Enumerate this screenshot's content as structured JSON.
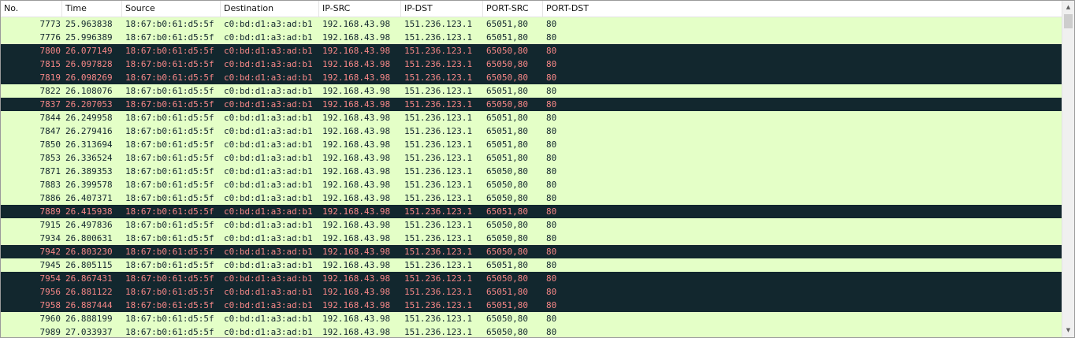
{
  "columns": {
    "no": "No.",
    "time": "Time",
    "source": "Source",
    "destination": "Destination",
    "ip_src": "IP-SRC",
    "ip_dst": "IP-DST",
    "port_src": "PORT-SRC",
    "port_dst": "PORT-DST"
  },
  "colors": {
    "normal_bg": "#e4ffc7",
    "normal_fg": "#12272e",
    "alert_bg": "#12272e",
    "alert_fg": "#f78787"
  },
  "scrollbar": {
    "up_icon": "▲",
    "down_icon": "▼"
  },
  "packets": [
    {
      "no": "7773",
      "time": "25.963838",
      "source": "18:67:b0:61:d5:5f",
      "destination": "c0:bd:d1:a3:ad:b1",
      "ip_src": "192.168.43.98",
      "ip_dst": "151.236.123.1",
      "port_src": "65051,80",
      "port_dst": "80",
      "style": "normal"
    },
    {
      "no": "7776",
      "time": "25.996389",
      "source": "18:67:b0:61:d5:5f",
      "destination": "c0:bd:d1:a3:ad:b1",
      "ip_src": "192.168.43.98",
      "ip_dst": "151.236.123.1",
      "port_src": "65051,80",
      "port_dst": "80",
      "style": "normal"
    },
    {
      "no": "7800",
      "time": "26.077149",
      "source": "18:67:b0:61:d5:5f",
      "destination": "c0:bd:d1:a3:ad:b1",
      "ip_src": "192.168.43.98",
      "ip_dst": "151.236.123.1",
      "port_src": "65050,80",
      "port_dst": "80",
      "style": "alert"
    },
    {
      "no": "7815",
      "time": "26.097828",
      "source": "18:67:b0:61:d5:5f",
      "destination": "c0:bd:d1:a3:ad:b1",
      "ip_src": "192.168.43.98",
      "ip_dst": "151.236.123.1",
      "port_src": "65050,80",
      "port_dst": "80",
      "style": "alert"
    },
    {
      "no": "7819",
      "time": "26.098269",
      "source": "18:67:b0:61:d5:5f",
      "destination": "c0:bd:d1:a3:ad:b1",
      "ip_src": "192.168.43.98",
      "ip_dst": "151.236.123.1",
      "port_src": "65050,80",
      "port_dst": "80",
      "style": "alert"
    },
    {
      "no": "7822",
      "time": "26.108076",
      "source": "18:67:b0:61:d5:5f",
      "destination": "c0:bd:d1:a3:ad:b1",
      "ip_src": "192.168.43.98",
      "ip_dst": "151.236.123.1",
      "port_src": "65051,80",
      "port_dst": "80",
      "style": "normal"
    },
    {
      "no": "7837",
      "time": "26.207053",
      "source": "18:67:b0:61:d5:5f",
      "destination": "c0:bd:d1:a3:ad:b1",
      "ip_src": "192.168.43.98",
      "ip_dst": "151.236.123.1",
      "port_src": "65050,80",
      "port_dst": "80",
      "style": "alert"
    },
    {
      "no": "7844",
      "time": "26.249958",
      "source": "18:67:b0:61:d5:5f",
      "destination": "c0:bd:d1:a3:ad:b1",
      "ip_src": "192.168.43.98",
      "ip_dst": "151.236.123.1",
      "port_src": "65051,80",
      "port_dst": "80",
      "style": "normal"
    },
    {
      "no": "7847",
      "time": "26.279416",
      "source": "18:67:b0:61:d5:5f",
      "destination": "c0:bd:d1:a3:ad:b1",
      "ip_src": "192.168.43.98",
      "ip_dst": "151.236.123.1",
      "port_src": "65051,80",
      "port_dst": "80",
      "style": "normal"
    },
    {
      "no": "7850",
      "time": "26.313694",
      "source": "18:67:b0:61:d5:5f",
      "destination": "c0:bd:d1:a3:ad:b1",
      "ip_src": "192.168.43.98",
      "ip_dst": "151.236.123.1",
      "port_src": "65051,80",
      "port_dst": "80",
      "style": "normal"
    },
    {
      "no": "7853",
      "time": "26.336524",
      "source": "18:67:b0:61:d5:5f",
      "destination": "c0:bd:d1:a3:ad:b1",
      "ip_src": "192.168.43.98",
      "ip_dst": "151.236.123.1",
      "port_src": "65051,80",
      "port_dst": "80",
      "style": "normal"
    },
    {
      "no": "7871",
      "time": "26.389353",
      "source": "18:67:b0:61:d5:5f",
      "destination": "c0:bd:d1:a3:ad:b1",
      "ip_src": "192.168.43.98",
      "ip_dst": "151.236.123.1",
      "port_src": "65050,80",
      "port_dst": "80",
      "style": "normal"
    },
    {
      "no": "7883",
      "time": "26.399578",
      "source": "18:67:b0:61:d5:5f",
      "destination": "c0:bd:d1:a3:ad:b1",
      "ip_src": "192.168.43.98",
      "ip_dst": "151.236.123.1",
      "port_src": "65050,80",
      "port_dst": "80",
      "style": "normal"
    },
    {
      "no": "7886",
      "time": "26.407371",
      "source": "18:67:b0:61:d5:5f",
      "destination": "c0:bd:d1:a3:ad:b1",
      "ip_src": "192.168.43.98",
      "ip_dst": "151.236.123.1",
      "port_src": "65050,80",
      "port_dst": "80",
      "style": "normal"
    },
    {
      "no": "7889",
      "time": "26.415938",
      "source": "18:67:b0:61:d5:5f",
      "destination": "c0:bd:d1:a3:ad:b1",
      "ip_src": "192.168.43.98",
      "ip_dst": "151.236.123.1",
      "port_src": "65051,80",
      "port_dst": "80",
      "style": "alert"
    },
    {
      "no": "7915",
      "time": "26.497836",
      "source": "18:67:b0:61:d5:5f",
      "destination": "c0:bd:d1:a3:ad:b1",
      "ip_src": "192.168.43.98",
      "ip_dst": "151.236.123.1",
      "port_src": "65050,80",
      "port_dst": "80",
      "style": "normal"
    },
    {
      "no": "7934",
      "time": "26.800631",
      "source": "18:67:b0:61:d5:5f",
      "destination": "c0:bd:d1:a3:ad:b1",
      "ip_src": "192.168.43.98",
      "ip_dst": "151.236.123.1",
      "port_src": "65050,80",
      "port_dst": "80",
      "style": "normal"
    },
    {
      "no": "7942",
      "time": "26.803230",
      "source": "18:67:b0:61:d5:5f",
      "destination": "c0:bd:d1:a3:ad:b1",
      "ip_src": "192.168.43.98",
      "ip_dst": "151.236.123.1",
      "port_src": "65050,80",
      "port_dst": "80",
      "style": "alert"
    },
    {
      "no": "7945",
      "time": "26.805115",
      "source": "18:67:b0:61:d5:5f",
      "destination": "c0:bd:d1:a3:ad:b1",
      "ip_src": "192.168.43.98",
      "ip_dst": "151.236.123.1",
      "port_src": "65051,80",
      "port_dst": "80",
      "style": "normal"
    },
    {
      "no": "7954",
      "time": "26.867431",
      "source": "18:67:b0:61:d5:5f",
      "destination": "c0:bd:d1:a3:ad:b1",
      "ip_src": "192.168.43.98",
      "ip_dst": "151.236.123.1",
      "port_src": "65050,80",
      "port_dst": "80",
      "style": "alert"
    },
    {
      "no": "7956",
      "time": "26.881122",
      "source": "18:67:b0:61:d5:5f",
      "destination": "c0:bd:d1:a3:ad:b1",
      "ip_src": "192.168.43.98",
      "ip_dst": "151.236.123.1",
      "port_src": "65051,80",
      "port_dst": "80",
      "style": "alert"
    },
    {
      "no": "7958",
      "time": "26.887444",
      "source": "18:67:b0:61:d5:5f",
      "destination": "c0:bd:d1:a3:ad:b1",
      "ip_src": "192.168.43.98",
      "ip_dst": "151.236.123.1",
      "port_src": "65051,80",
      "port_dst": "80",
      "style": "alert"
    },
    {
      "no": "7960",
      "time": "26.888199",
      "source": "18:67:b0:61:d5:5f",
      "destination": "c0:bd:d1:a3:ad:b1",
      "ip_src": "192.168.43.98",
      "ip_dst": "151.236.123.1",
      "port_src": "65050,80",
      "port_dst": "80",
      "style": "normal"
    },
    {
      "no": "7989",
      "time": "27.033937",
      "source": "18:67:b0:61:d5:5f",
      "destination": "c0:bd:d1:a3:ad:b1",
      "ip_src": "192.168.43.98",
      "ip_dst": "151.236.123.1",
      "port_src": "65050,80",
      "port_dst": "80",
      "style": "normal"
    }
  ]
}
